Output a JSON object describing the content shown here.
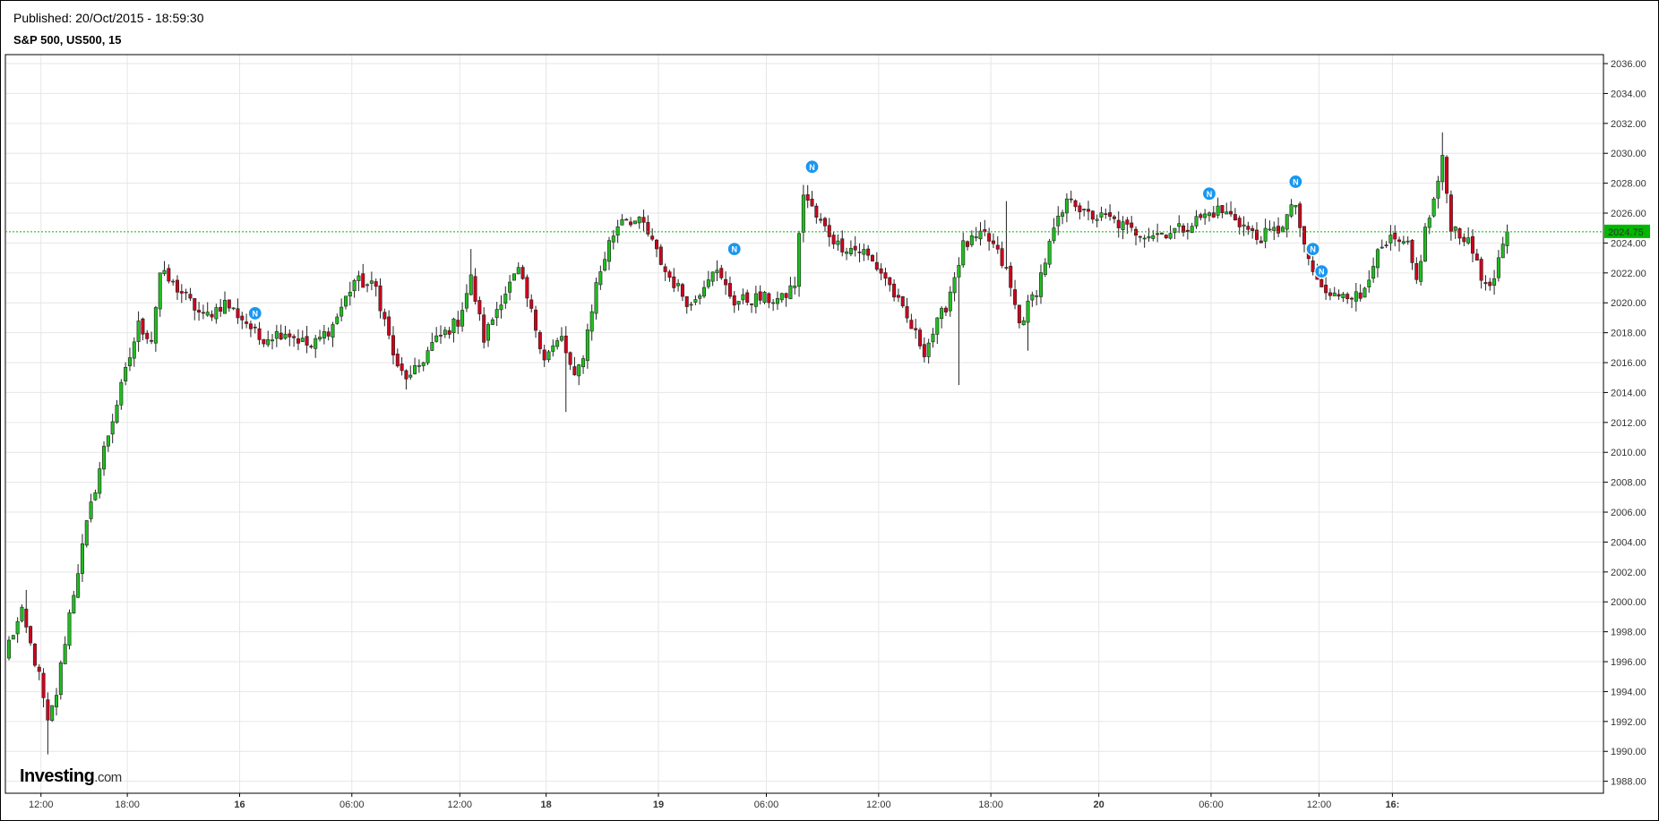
{
  "header": {
    "published": "Published: 20/Oct/2015  -  18:59:30",
    "symbol": "S&P 500, US500, 15"
  },
  "logo": {
    "brand": "Investing",
    "suffix": ".com"
  },
  "colors": {
    "up": "#1fbf1f",
    "down": "#d0021b",
    "grid": "#e6e6e6",
    "last_price": "#00b800",
    "news": "#1a97ef"
  },
  "chart_data": {
    "type": "candlestick",
    "title": "S&P 500, US500, 15",
    "ylim": [
      1987.2,
      2036.6
    ],
    "y_ticks": [
      "2036.00",
      "2034.00",
      "2032.00",
      "2030.00",
      "2028.00",
      "2026.00",
      "2024.00",
      "2022.00",
      "2020.00",
      "2018.00",
      "2016.00",
      "2014.00",
      "2012.00",
      "2010.00",
      "2008.00",
      "2006.00",
      "2004.00",
      "2002.00",
      "2000.00",
      "1998.00",
      "1996.00",
      "1994.00",
      "1992.00",
      "1990.00",
      "1988.00"
    ],
    "x_ticks": [
      "12:00",
      "18:00",
      "16",
      "06:00",
      "12:00",
      "18",
      "19",
      "06:00",
      "12:00",
      "18:00",
      "20",
      "06:00",
      "12:00",
      "16:"
    ],
    "last_price": 2024.75,
    "last_price_label": "2024.75",
    "news_marker_label": "N",
    "news_markers": [
      {
        "bar": 57,
        "price": 2019.3
      },
      {
        "bar": 168,
        "price": 2023.6
      },
      {
        "bar": 186,
        "price": 2029.1
      },
      {
        "bar": 278,
        "price": 2027.3
      },
      {
        "bar": 298,
        "price": 2028.1
      },
      {
        "bar": 302,
        "price": 2023.6
      },
      {
        "bar": 304,
        "price": 2022.1
      }
    ],
    "bar_count": 348,
    "anchors": [
      [
        0,
        1997.3
      ],
      [
        3,
        1999.2
      ],
      [
        7,
        1995.0
      ],
      [
        9,
        1991.8
      ],
      [
        11,
        1993.9
      ],
      [
        14,
        1999.2
      ],
      [
        18,
        2005.1
      ],
      [
        22,
        2010.2
      ],
      [
        26,
        2014.3
      ],
      [
        30,
        2018.5
      ],
      [
        33,
        2017.6
      ],
      [
        35,
        2022.0
      ],
      [
        40,
        2020.7
      ],
      [
        45,
        2019.0
      ],
      [
        50,
        2020.0
      ],
      [
        55,
        2018.7
      ],
      [
        58,
        2017.6
      ],
      [
        64,
        2018.1
      ],
      [
        70,
        2017.0
      ],
      [
        75,
        2018.5
      ],
      [
        80,
        2021.5
      ],
      [
        85,
        2021.0
      ],
      [
        90,
        2015.5
      ],
      [
        93,
        2014.9
      ],
      [
        98,
        2017.2
      ],
      [
        104,
        2018.8
      ],
      [
        107,
        2021.6
      ],
      [
        110,
        2017.6
      ],
      [
        114,
        2020.3
      ],
      [
        118,
        2022.1
      ],
      [
        121,
        2019.3
      ],
      [
        124,
        2016.4
      ],
      [
        128,
        2017.6
      ],
      [
        131,
        2014.8
      ],
      [
        133,
        2016.6
      ],
      [
        136,
        2021.2
      ],
      [
        139,
        2024.0
      ],
      [
        142,
        2025.8
      ],
      [
        147,
        2025.2
      ],
      [
        152,
        2022.1
      ],
      [
        158,
        2019.8
      ],
      [
        163,
        2022.4
      ],
      [
        168,
        2020.1
      ],
      [
        174,
        2020.3
      ],
      [
        179,
        2020.2
      ],
      [
        182,
        2021.3
      ],
      [
        184,
        2027.4
      ],
      [
        187,
        2025.7
      ],
      [
        192,
        2023.9
      ],
      [
        198,
        2023.4
      ],
      [
        203,
        2021.7
      ],
      [
        207,
        2019.4
      ],
      [
        212,
        2016.8
      ],
      [
        217,
        2019.8
      ],
      [
        221,
        2023.8
      ],
      [
        226,
        2024.5
      ],
      [
        228,
        2023.8
      ],
      [
        231,
        2022.1
      ],
      [
        234,
        2018.6
      ],
      [
        238,
        2020.9
      ],
      [
        242,
        2024.8
      ],
      [
        246,
        2027.2
      ],
      [
        249,
        2025.9
      ],
      [
        255,
        2025.6
      ],
      [
        260,
        2024.8
      ],
      [
        266,
        2024.6
      ],
      [
        272,
        2025.0
      ],
      [
        276,
        2025.7
      ],
      [
        280,
        2026.2
      ],
      [
        284,
        2025.7
      ],
      [
        289,
        2024.3
      ],
      [
        294,
        2024.9
      ],
      [
        298,
        2026.6
      ],
      [
        300,
        2023.5
      ],
      [
        303,
        2021.4
      ],
      [
        306,
        2020.3
      ],
      [
        309,
        2020.8
      ],
      [
        313,
        2020.3
      ],
      [
        316,
        2022.8
      ],
      [
        320,
        2024.1
      ],
      [
        324,
        2023.7
      ],
      [
        326,
        2021.4
      ],
      [
        328,
        2024.8
      ],
      [
        330,
        2026.8
      ],
      [
        332,
        2029.5
      ],
      [
        334,
        2025.2
      ],
      [
        337,
        2024.4
      ],
      [
        340,
        2022.9
      ],
      [
        342,
        2020.9
      ],
      [
        344,
        2021.5
      ],
      [
        347,
        2024.75
      ]
    ],
    "volatility_spikes": [
      {
        "bar": 92,
        "low": 2014.2
      },
      {
        "bar": 107,
        "high": 2023.6
      },
      {
        "bar": 129,
        "low": 2012.7
      },
      {
        "bar": 220,
        "low": 2014.5
      },
      {
        "bar": 231,
        "high": 2026.8
      },
      {
        "bar": 236,
        "low": 2016.8
      },
      {
        "bar": 9,
        "low": 1989.8
      },
      {
        "bar": 4,
        "high": 2000.8
      },
      {
        "bar": 332,
        "high": 2031.4
      }
    ]
  }
}
